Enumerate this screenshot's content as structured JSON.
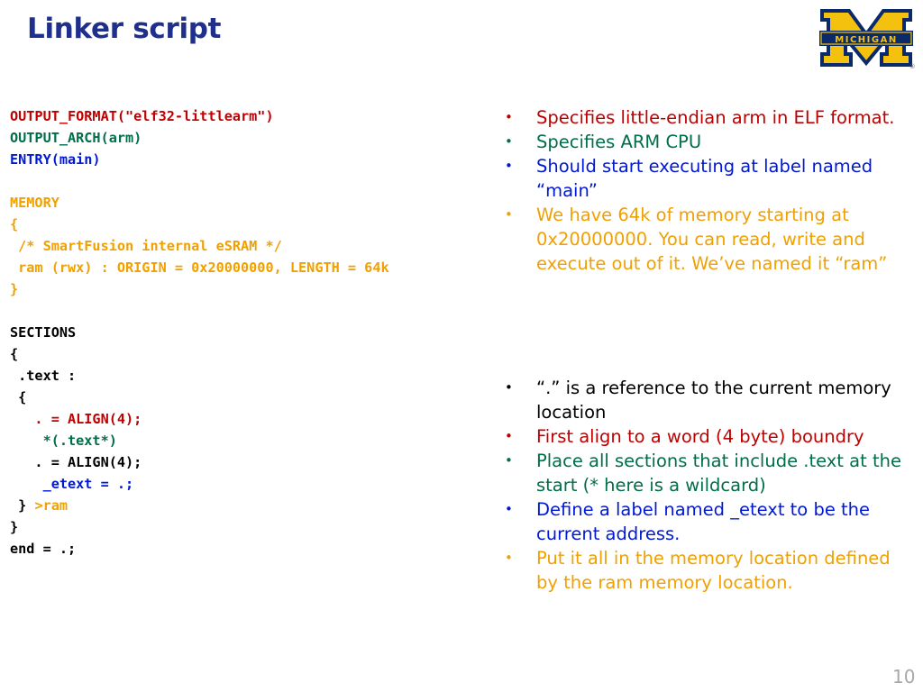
{
  "slide": {
    "title": "Linker script",
    "page_number": "10",
    "logo_text": "MICHIGAN",
    "logo_mark": "®"
  },
  "colors": {
    "title": "#1f2f8c",
    "red": "#c00000",
    "green": "#006e4a",
    "blue": "#0018d8",
    "orange": "#f0a000",
    "black": "#000000",
    "maize": "#f4c20e",
    "logo_blue": "#0a2a6b"
  },
  "code": [
    {
      "text": "OUTPUT_FORMAT(\"elf32-littlearm\")",
      "color": "red"
    },
    {
      "text": "OUTPUT_ARCH(arm)",
      "color": "green"
    },
    {
      "text": "ENTRY(main)",
      "color": "blue"
    },
    {
      "text": "",
      "color": "black"
    },
    {
      "text": "MEMORY",
      "color": "orange"
    },
    {
      "text": "{",
      "color": "orange"
    },
    {
      "text": " /* SmartFusion internal eSRAM */",
      "color": "orange"
    },
    {
      "text": " ram (rwx) : ORIGIN = 0x20000000, LENGTH = 64k",
      "color": "orange"
    },
    {
      "text": "}",
      "color": "orange"
    },
    {
      "text": "",
      "color": "black"
    },
    {
      "text": "SECTIONS",
      "color": "black"
    },
    {
      "text": "{",
      "color": "black"
    },
    {
      "text": " .text :",
      "color": "black"
    },
    {
      "text": " {",
      "color": "black"
    },
    {
      "text": "   . = ALIGN(4);",
      "color": "red"
    },
    {
      "text": "    *(.text*)",
      "color": "green"
    },
    {
      "text": "   . = ALIGN(4);",
      "color": "black"
    },
    {
      "text": "    _etext = .;",
      "color": "blue"
    },
    {
      "text": " } ",
      "color": "black",
      "extra": {
        "text": ">ram",
        "color": "orange"
      }
    },
    {
      "text": "}",
      "color": "black"
    },
    {
      "text": "end = .;",
      "color": "black"
    }
  ],
  "bullets_top": [
    {
      "text": "Specifies little-endian arm in ELF format.",
      "color": "red"
    },
    {
      "text": "Specifies ARM CPU",
      "color": "green"
    },
    {
      "text": "Should start executing at label named “main”",
      "color": "blue"
    },
    {
      "text": "We have 64k of memory starting at 0x20000000.  You can read, write and execute out of it.  We’ve named it “ram”",
      "color": "orange"
    }
  ],
  "bullets_bottom": [
    {
      "text": "“.” is a reference to the current memory location",
      "color": "black"
    },
    {
      "text": "First align to a word (4 byte) boundry",
      "color": "red"
    },
    {
      "text": "Place all sections that include .text at the start (* here is a wildcard)",
      "color": "green"
    },
    {
      "text": "Define a label named _etext to be the current address.",
      "color": "blue"
    },
    {
      "text": "Put it all in the memory location defined by the ram memory location.",
      "color": "orange"
    }
  ],
  "bullet_glyph": "•"
}
